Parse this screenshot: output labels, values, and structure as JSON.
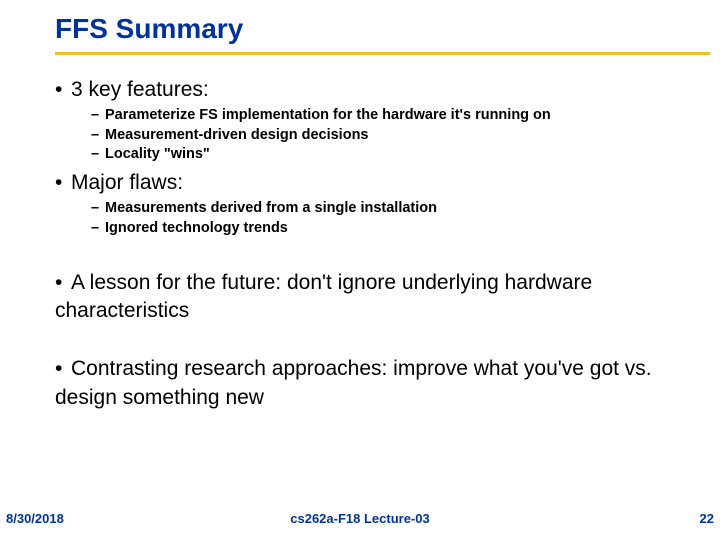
{
  "title": "FFS Summary",
  "bullets": {
    "b1": "3 key features:",
    "b1subs": [
      "Parameterize FS implementation for the hardware it's running on",
      "Measurement-driven design decisions",
      "Locality \"wins\""
    ],
    "b2": "Major flaws:",
    "b2subs": [
      "Measurements derived from a single installation",
      "Ignored technology trends"
    ],
    "b3": "A lesson for the future: don't ignore underlying hardware characteristics",
    "b4": "Contrasting research approaches: improve what you've got vs. design something new"
  },
  "footer": {
    "date": "8/30/2018",
    "center": "cs262a-F18 Lecture-03",
    "page": "22"
  }
}
